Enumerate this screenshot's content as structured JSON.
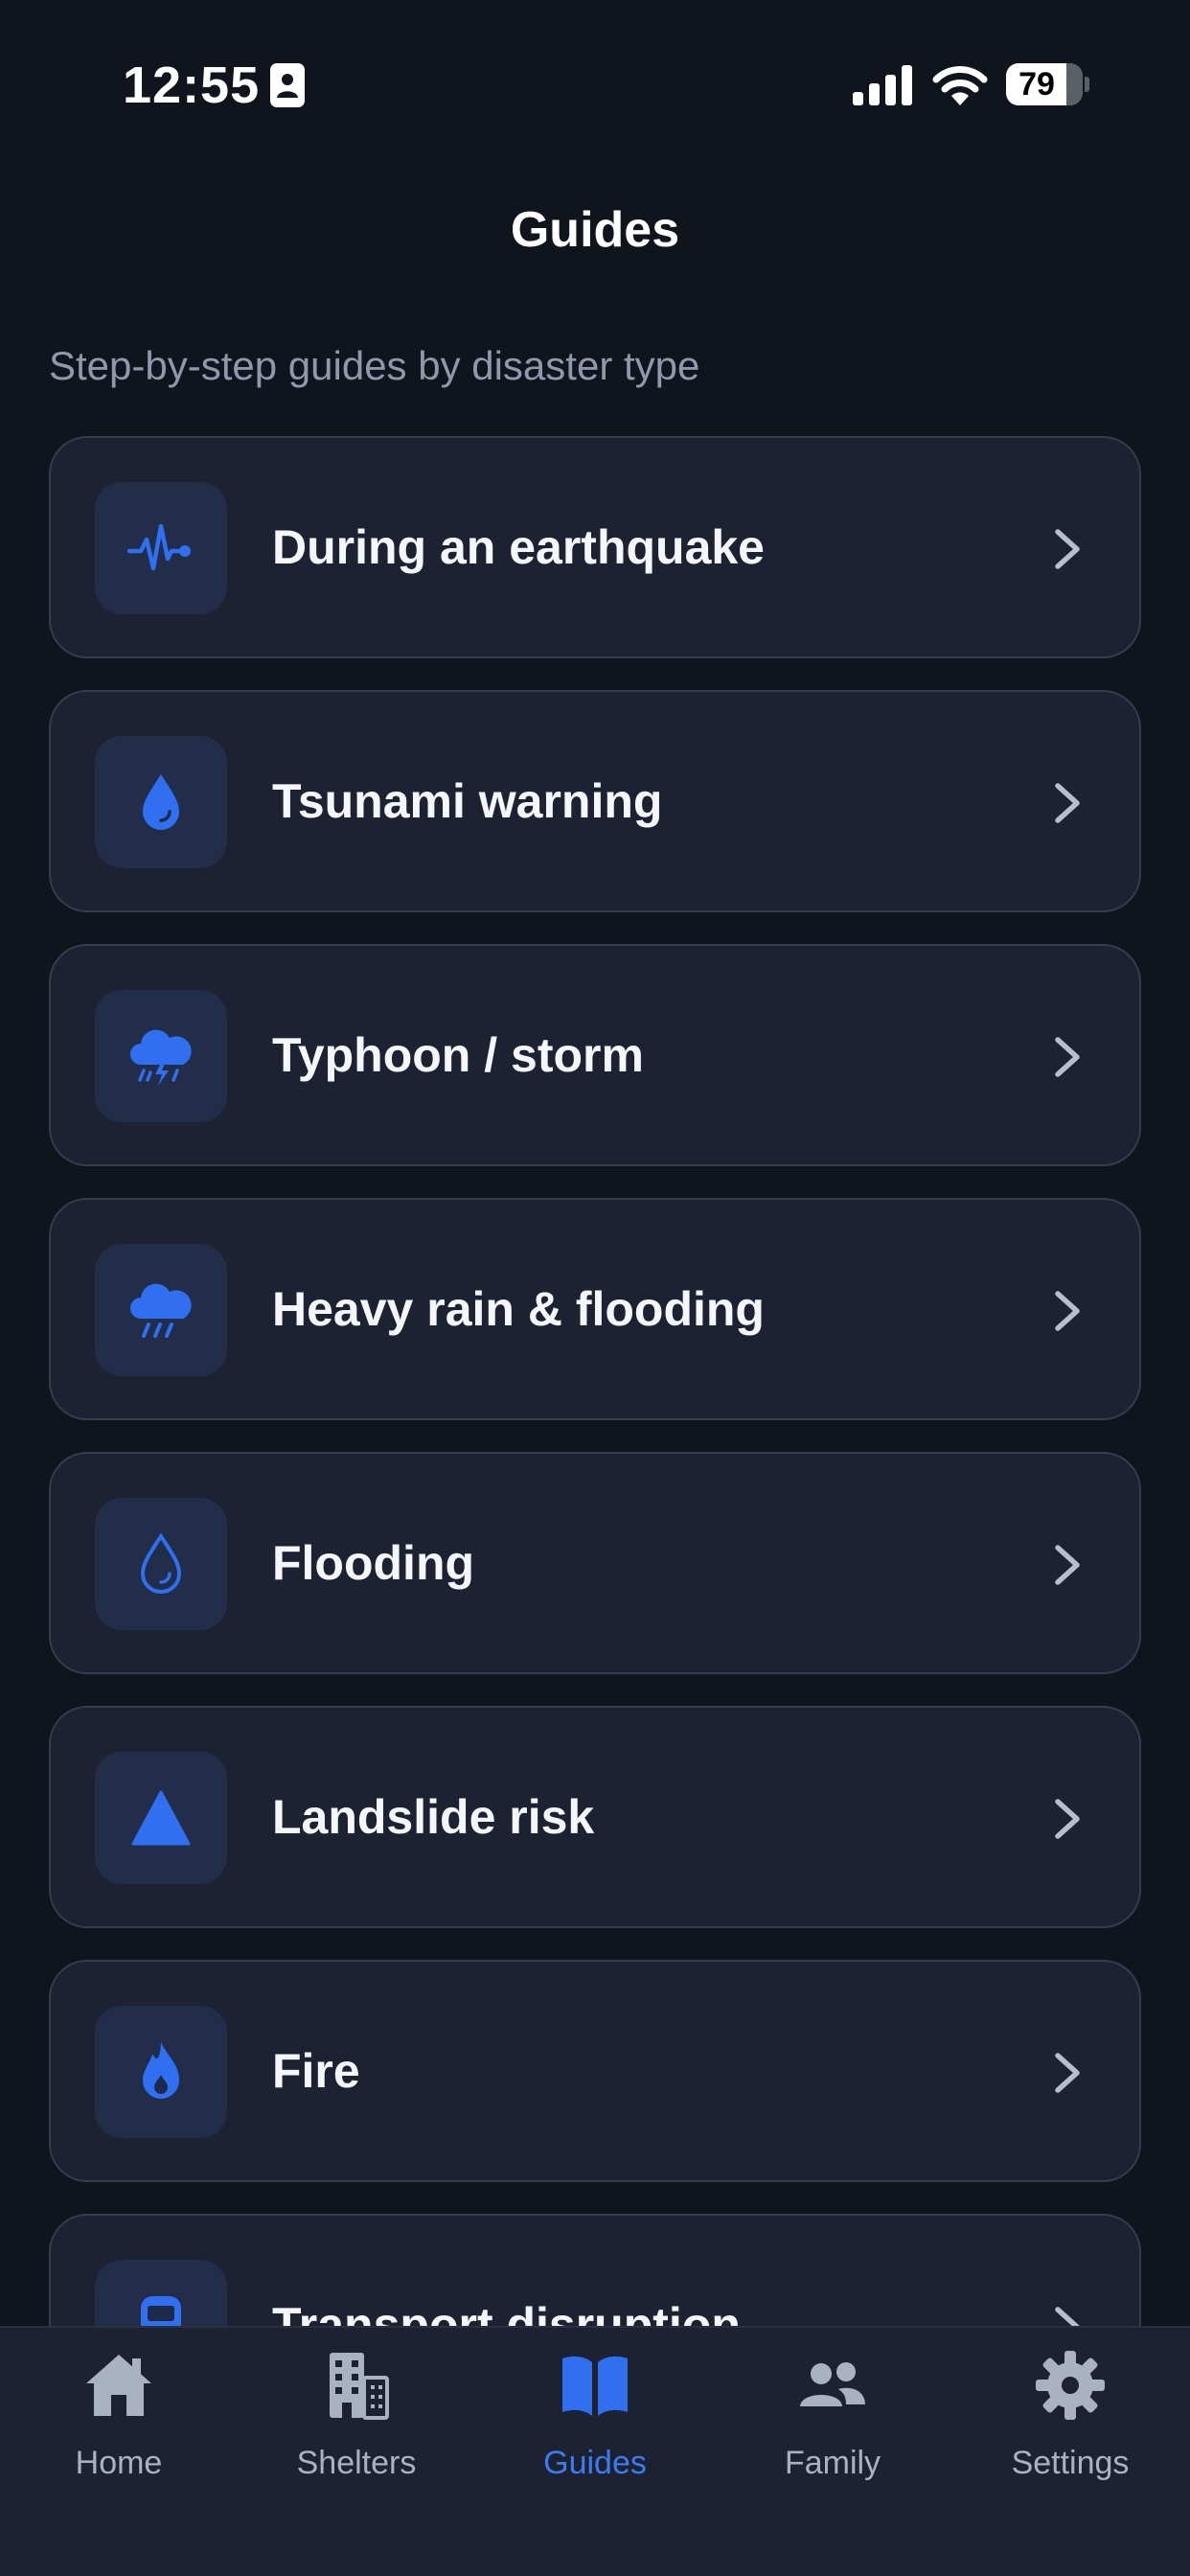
{
  "status_bar": {
    "time": "12:55",
    "battery": "79",
    "battery_level": 0.79
  },
  "header": {
    "title": "Guides",
    "subtitle": "Step-by-step guides by disaster type"
  },
  "colors": {
    "accent": "#2f6ff0",
    "background": "#10141d",
    "card": "#1c2231",
    "card_border": "#353d4e",
    "icon_tile": "#212d49",
    "tab_inactive": "#aab2c2"
  },
  "guides": [
    {
      "label": "During an earthquake",
      "icon": "pulse-icon"
    },
    {
      "label": "Tsunami warning",
      "icon": "water-drop-icon"
    },
    {
      "label": "Typhoon / storm",
      "icon": "thunderstorm-icon"
    },
    {
      "label": "Heavy rain & flooding",
      "icon": "rain-cloud-icon"
    },
    {
      "label": "Flooding",
      "icon": "drop-outline-icon"
    },
    {
      "label": "Landslide risk",
      "icon": "triangle-icon"
    },
    {
      "label": "Fire",
      "icon": "flame-icon"
    },
    {
      "label": "Transport disruption",
      "icon": "train-icon"
    }
  ],
  "tab_bar": {
    "tabs": [
      {
        "label": "Home",
        "icon": "home-icon"
      },
      {
        "label": "Shelters",
        "icon": "building-icon"
      },
      {
        "label": "Guides",
        "icon": "book-icon",
        "active": true
      },
      {
        "label": "Family",
        "icon": "people-icon"
      },
      {
        "label": "Settings",
        "icon": "gear-icon"
      }
    ]
  }
}
